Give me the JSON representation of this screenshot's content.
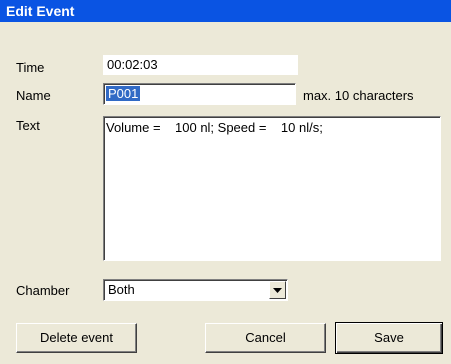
{
  "window": {
    "title": "Edit Event"
  },
  "form": {
    "time_label": "Time",
    "time_value": "00:02:03",
    "name_label": "Name",
    "name_value": "P001",
    "name_hint": "max. 10 characters",
    "text_label": "Text",
    "text_value": "Volume =    100 nl; Speed =    10 nl/s;",
    "chamber_label": "Chamber",
    "chamber_value": "Both"
  },
  "buttons": {
    "delete_label": "Delete event",
    "cancel_label": "Cancel",
    "save_label": "Save"
  },
  "icons": {
    "dropdown": "chevron-down-icon"
  },
  "colors": {
    "titlebar": "#0a54e3",
    "dialog_bg": "#ece9d8",
    "selection": "#316ac5"
  }
}
